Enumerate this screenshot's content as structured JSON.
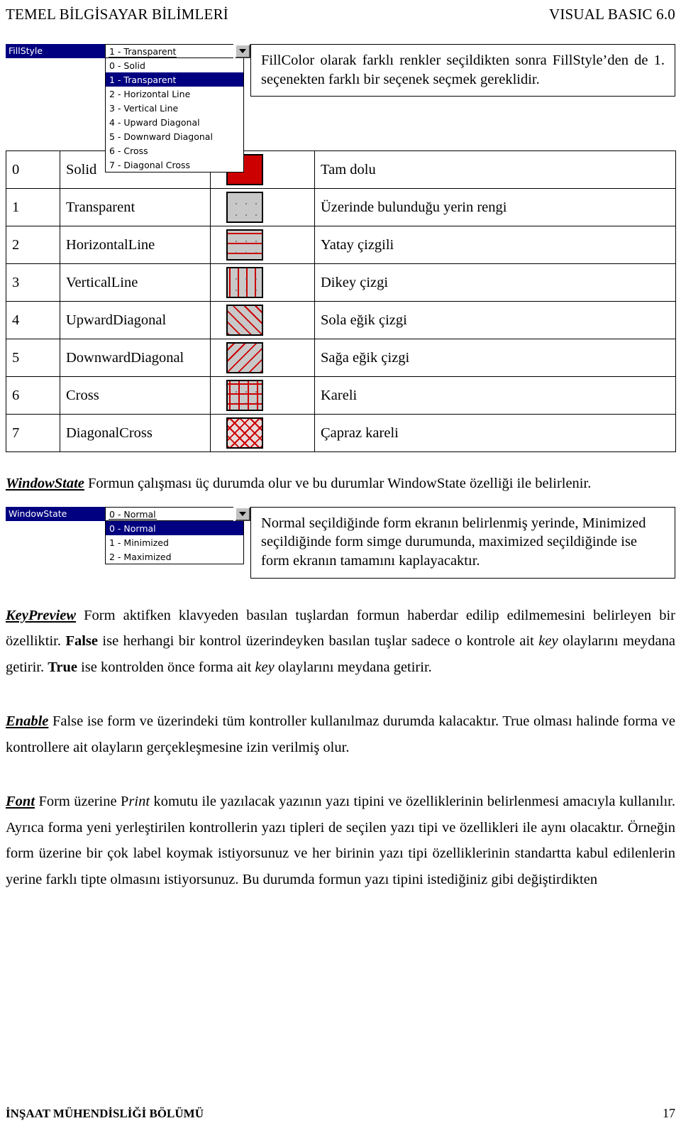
{
  "header": {
    "left": "TEMEL BİLGİSAYAR BİLİMLERİ",
    "right": "VISUAL BASIC 6.0"
  },
  "fillstyle_widget": {
    "property_name": "FillStyle",
    "selected_value": "1 - Transparent",
    "arrow_icon": "chevron-down-icon",
    "options": [
      "0 - Solid",
      "1 - Transparent",
      "2 - Horizontal Line",
      "3 - Vertical Line",
      "4 - Upward Diagonal",
      "5 - Downward Diagonal",
      "6 - Cross",
      "7 - Diagonal Cross"
    ],
    "selected_index": 1
  },
  "fillstyle_note": "FillColor olarak farklı renkler seçildikten sonra FillStyle’den de 1. seçenekten farklı bir seçenek seçmek gereklidir.",
  "fill_table": {
    "rows": [
      {
        "index": "0",
        "name": "Solid",
        "swatch": "sw-solid",
        "desc": "Tam dolu"
      },
      {
        "index": "1",
        "name": "Transparent",
        "swatch": "sw-dots",
        "desc": "Üzerinde bulunduğu yerin rengi"
      },
      {
        "index": "2",
        "name": "HorizontalLine",
        "swatch": "sw-horiz",
        "desc": "Yatay çizgili"
      },
      {
        "index": "3",
        "name": "VerticalLine",
        "swatch": "sw-vert",
        "desc": "Dikey çizgi"
      },
      {
        "index": "4",
        "name": "UpwardDiagonal",
        "swatch": "sw-updiag",
        "desc": "Sola eğik çizgi"
      },
      {
        "index": "5",
        "name": "DownwardDiagonal",
        "swatch": "sw-downdiag",
        "desc": "Sağa eğik çizgi"
      },
      {
        "index": "6",
        "name": "Cross",
        "swatch": "sw-cross",
        "desc": "Kareli"
      },
      {
        "index": "7",
        "name": "DiagonalCross",
        "swatch": "sw-diagcross",
        "desc": "Çapraz kareli"
      }
    ]
  },
  "windowstate": {
    "term": "WindowState",
    "intro": " Formun çalışması üç durumda olur ve bu durumlar WindowState özelliği ile belirlenir.",
    "widget": {
      "property_name": "WindowState",
      "selected_value": "0 - Normal",
      "arrow_icon": "chevron-down-icon",
      "options": [
        "0 - Normal",
        "1 - Minimized",
        "2 - Maximized"
      ],
      "selected_index": 0
    },
    "note": "Normal seçildiğinde form ekranın belirlenmiş yerinde, Minimized seçildiğinde form simge durumunda, maximized seçildiğinde ise form ekranın tamamını kaplayacaktır."
  },
  "keypreview": {
    "term": "KeyPreview",
    "part1": " Form aktifken klavyeden basılan tuşlardan formun haberdar edilip edilmemesini belirleyen bir özelliktir. ",
    "bold1": "False",
    "part2": " ise herhangi bir kontrol üzerindeyken basılan tuşlar sadece o kontrole ait ",
    "italic1": "key",
    "part3": " olaylarını meydana getirir. ",
    "bold2": "True",
    "part4": " ise kontrolden önce forma ait ",
    "italic2": "key",
    "part5": "  olaylarını meydana getirir."
  },
  "enable": {
    "term": "Enable",
    "text": " False ise form ve üzerindeki tüm kontroller kullanılmaz durumda kalacaktır. True olması halinde forma ve kontrollere ait olayların gerçekleşmesine izin verilmiş olur."
  },
  "font": {
    "term": "Font",
    "part1": " Form üzerine ",
    "print_p": "P",
    "print_rint": "rint",
    "part2": " komutu ile yazılacak yazının yazı tipini ve özelliklerinin belirlenmesi amacıyla kullanılır. Ayrıca forma yeni yerleştirilen kontrollerin yazı tipleri de seçilen yazı tipi ve özellikleri ile aynı olacaktır. Örneğin form üzerine bir çok label koymak istiyorsunuz ve her birinin yazı tipi özelliklerinin standartta kabul edilenlerin yerine farklı tipte olmasını istiyorsunuz. Bu durumda formun yazı tipini istediğiniz gibi değiştirdikten"
  },
  "footer": {
    "left": "İNŞAAT MÜHENDİSLİĞİ BÖLÜMÜ",
    "page": "17"
  }
}
